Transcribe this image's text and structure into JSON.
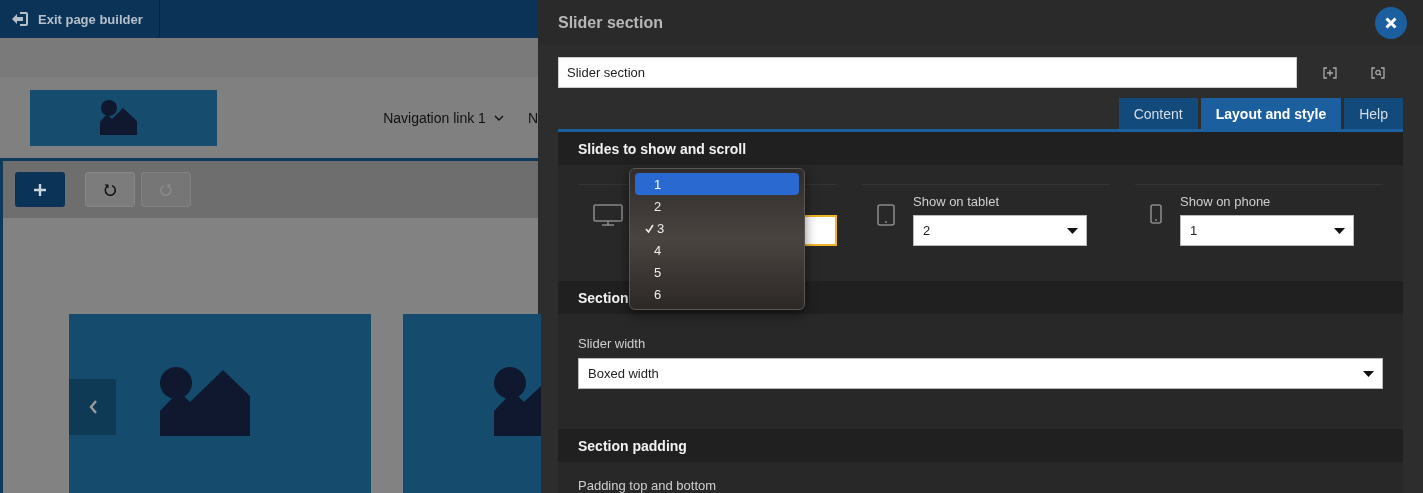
{
  "topbar": {
    "exit_label": "Exit page builder"
  },
  "preview": {
    "nav_links": [
      {
        "label": "Navigation link 1",
        "has_menu": true
      },
      {
        "label": "N",
        "has_menu": false
      }
    ],
    "history_buttons": [
      {
        "kind": "undo",
        "disabled": false
      },
      {
        "kind": "redo",
        "disabled": true
      }
    ]
  },
  "panel": {
    "title": "Slider section",
    "name_value": "Slider section",
    "tabs": [
      {
        "label": "Content",
        "selected": false
      },
      {
        "label": "Layout and style",
        "selected": true
      },
      {
        "label": "Help",
        "selected": false
      }
    ],
    "sections": [
      {
        "title": "Slides to show and scroll",
        "kind": "devices",
        "devices": [
          {
            "kind": "desktop"
          },
          {
            "kind": "tablet",
            "label": "Show on tablet",
            "value": "2"
          },
          {
            "kind": "phone",
            "label": "Show on phone",
            "value": "1"
          }
        ]
      },
      {
        "title": "Section",
        "kind": "select",
        "label": "Slider width",
        "value": "Boxed width"
      },
      {
        "title": "Section padding",
        "kind": "label",
        "label": "Padding top and bottom"
      }
    ]
  },
  "dropdown": {
    "options": [
      {
        "label": "1",
        "highlighted": true,
        "checked": false
      },
      {
        "label": "2",
        "highlighted": false,
        "checked": false
      },
      {
        "label": "3",
        "highlighted": false,
        "checked": true
      },
      {
        "label": "4",
        "highlighted": false,
        "checked": false
      },
      {
        "label": "5",
        "highlighted": false,
        "checked": false
      },
      {
        "label": "6",
        "highlighted": false,
        "checked": false
      }
    ]
  }
}
